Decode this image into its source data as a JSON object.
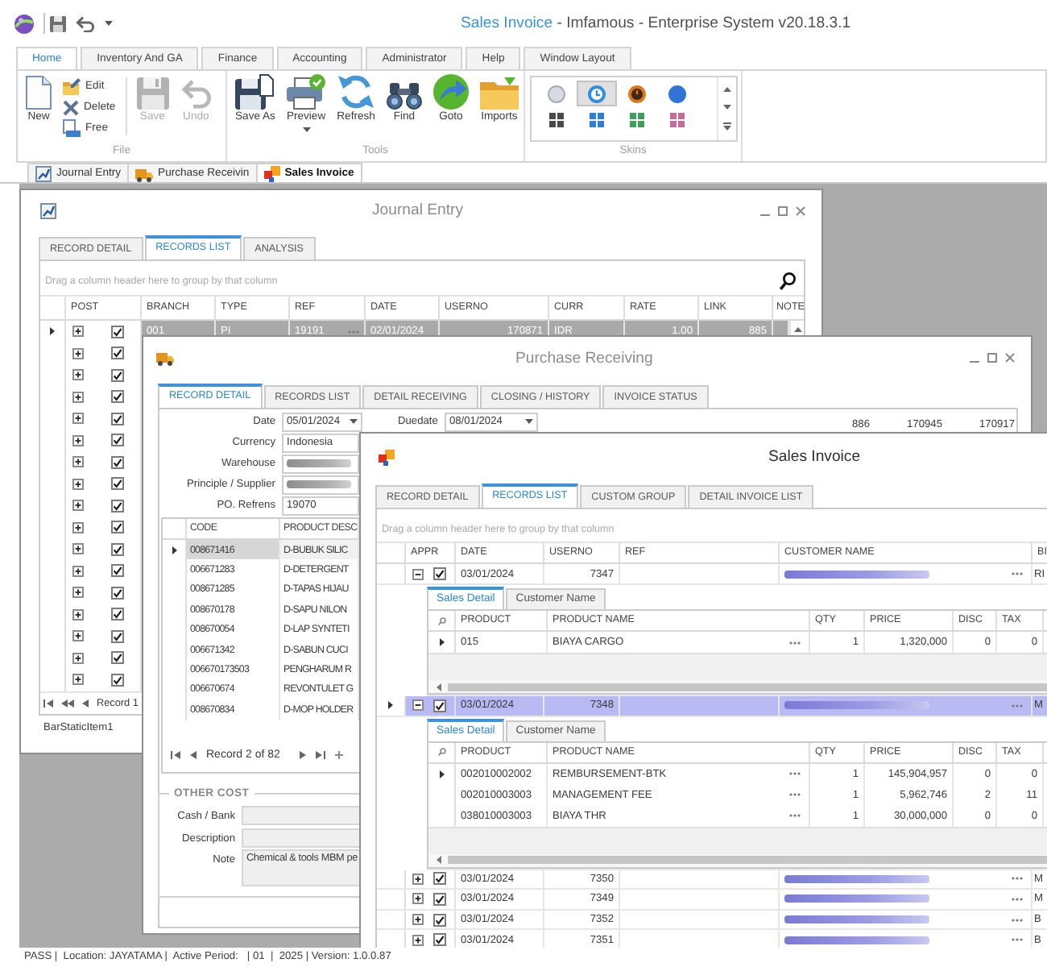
{
  "window": {
    "title": "Sales Invoice",
    "subtitle": "- Imfamous - Enterprise System v20.18.3.1"
  },
  "ribbon": {
    "tabs": [
      {
        "label": "Home",
        "selected": true
      },
      {
        "label": "Inventory And GA",
        "selected": false
      },
      {
        "label": "Finance",
        "selected": false
      },
      {
        "label": "Accounting",
        "selected": false
      },
      {
        "label": "Administrator",
        "selected": false
      },
      {
        "label": "Help",
        "selected": false
      },
      {
        "label": "Window Layout",
        "selected": false
      }
    ],
    "groups": [
      {
        "label": "File",
        "kind": "buttons",
        "items": [
          {
            "kind": "large",
            "label": "New",
            "disabled": false
          },
          {
            "kind": "small",
            "label": "Edit",
            "disabled": false
          },
          {
            "kind": "small",
            "label": "Delete",
            "disabled": false
          },
          {
            "kind": "small",
            "label": "Free",
            "disabled": false
          },
          {
            "kind": "large",
            "label": "Save",
            "disabled": true
          },
          {
            "kind": "large",
            "label": "Undo",
            "disabled": true
          }
        ]
      },
      {
        "label": "Tools",
        "kind": "buttons",
        "items": [
          {
            "kind": "large",
            "label": "Save As",
            "disabled": false
          },
          {
            "kind": "menu",
            "label": "Preview",
            "disabled": false
          },
          {
            "kind": "large",
            "label": "Refresh",
            "disabled": false
          },
          {
            "kind": "large",
            "label": "Find",
            "disabled": false
          },
          {
            "kind": "large",
            "label": "Goto",
            "disabled": false
          },
          {
            "kind": "large",
            "label": "Imports",
            "disabled": false
          }
        ]
      },
      {
        "label": "Skins",
        "kind": "gallery",
        "items": [
          {
            "selected": false
          },
          {
            "selected": true
          },
          {
            "selected": false
          },
          {
            "selected": false
          },
          {
            "selected": false
          },
          {
            "selected": false
          },
          {
            "selected": false
          },
          {
            "selected": false
          }
        ]
      }
    ]
  },
  "document_tabs": [
    {
      "label": "Journal Entry",
      "selected": false
    },
    {
      "label": "Purchase Receivin",
      "selected": false
    },
    {
      "label": "Sales Invoice",
      "selected": true
    }
  ],
  "windows": [
    {
      "kind": "journal",
      "title": "Journal Entry",
      "active": false,
      "controls": true,
      "tabs": [
        {
          "label": "RECORD DETAIL",
          "selected": false
        },
        {
          "label": "RECORDS LIST",
          "selected": true
        },
        {
          "label": "ANALYSIS",
          "selected": false
        }
      ],
      "group_hint": "Drag a column header here to group by that column",
      "columns": [
        "POST",
        "BRANCH",
        "TYPE",
        "REF",
        "DATE",
        "USERNO",
        "CURR",
        "RATE",
        "LINK",
        "NOTE"
      ],
      "rows": [
        {
          "selected": true,
          "expanded": false,
          "posted": true,
          "cells": [
            "001",
            "PI",
            "19191",
            "02/01/2024",
            "170871",
            "IDR",
            "1.00",
            "885"
          ]
        },
        {
          "selected": false,
          "expanded": false,
          "posted": true
        },
        {
          "selected": false,
          "expanded": false,
          "posted": true
        },
        {
          "selected": false,
          "expanded": false,
          "posted": true
        },
        {
          "selected": false,
          "expanded": false,
          "posted": true
        },
        {
          "selected": false,
          "expanded": false,
          "posted": true
        },
        {
          "selected": false,
          "expanded": false,
          "posted": true
        },
        {
          "selected": false,
          "expanded": false,
          "posted": true
        },
        {
          "selected": false,
          "expanded": false,
          "posted": true
        },
        {
          "selected": false,
          "expanded": false,
          "posted": true
        },
        {
          "selected": false,
          "expanded": false,
          "posted": true
        },
        {
          "selected": false,
          "expanded": false,
          "posted": true
        },
        {
          "selected": false,
          "expanded": false,
          "posted": true
        },
        {
          "selected": false,
          "expanded": false,
          "posted": true
        },
        {
          "selected": false,
          "expanded": false,
          "posted": true
        },
        {
          "selected": false,
          "expanded": false,
          "posted": true
        },
        {
          "selected": false,
          "expanded": false,
          "posted": true
        }
      ],
      "navigator": "Record 1",
      "footer": "BarStaticItem1"
    },
    {
      "kind": "receiving",
      "title": "Purchase Receiving",
      "active": false,
      "controls": true,
      "tabs": [
        {
          "label": "RECORD DETAIL",
          "selected": true
        },
        {
          "label": "RECORDS LIST",
          "selected": false
        },
        {
          "label": "DETAIL RECEIVING",
          "selected": false
        },
        {
          "label": "CLOSING / HISTORY",
          "selected": false
        },
        {
          "label": "INVOICE STATUS",
          "selected": false
        }
      ],
      "fields": [
        {
          "label": "Date",
          "kind": "date",
          "value": "05/01/2024"
        },
        {
          "label": "Currency",
          "kind": "text",
          "value": "Indonesia"
        },
        {
          "label": "Warehouse",
          "kind": "blurred"
        },
        {
          "label": "Principle / Supplier",
          "kind": "blurred"
        },
        {
          "label": "PO. Refrens",
          "kind": "text",
          "value": "19070"
        }
      ],
      "due_field": {
        "label": "Duedate",
        "kind": "date",
        "value": "08/01/2024"
      },
      "side_values": [
        "886",
        "170945",
        "170917"
      ],
      "columns": [
        "CODE",
        "PRODUCT DESC"
      ],
      "rows": [
        {
          "selected": true,
          "cells": [
            "008671416",
            "D-BUBUK SILIC"
          ]
        },
        {
          "selected": false,
          "cells": [
            "006671283",
            "D-DETERGENT"
          ]
        },
        {
          "selected": false,
          "cells": [
            "008671285",
            "D-TAPAS HIJAU"
          ]
        },
        {
          "selected": false,
          "cells": [
            "008670178",
            "D-SAPU NILON"
          ]
        },
        {
          "selected": false,
          "cells": [
            "008670054",
            "D-LAP SYNTETI"
          ]
        },
        {
          "selected": false,
          "cells": [
            "006671342",
            "D-SABUN CUCI"
          ]
        },
        {
          "selected": false,
          "cells": [
            "006670173503",
            "PENGHARUM R"
          ]
        },
        {
          "selected": false,
          "cells": [
            "006670674",
            "REVONTULET G"
          ]
        },
        {
          "selected": false,
          "cells": [
            "008670834",
            "D-MOP HOLDER"
          ]
        }
      ],
      "navigator": "Record 2 of 82",
      "other_cost": {
        "title": "OTHER COST",
        "fields": [
          {
            "label": "Cash / Bank",
            "kind": "text"
          },
          {
            "label": "Description",
            "kind": "text"
          },
          {
            "label": "Note",
            "kind": "memo",
            "value": "Chemical & tools MBM pe"
          }
        ]
      }
    },
    {
      "kind": "invoice",
      "title": "Sales Invoice",
      "active": true,
      "tabs": [
        {
          "label": "RECORD DETAIL",
          "selected": false
        },
        {
          "label": "RECORDS LIST",
          "selected": true
        },
        {
          "label": "CUSTOM GROUP",
          "selected": false
        },
        {
          "label": "DETAIL INVOICE LIST",
          "selected": false
        }
      ],
      "group_hint": "Drag a column header here to group by that column",
      "columns": [
        "APPR",
        "DATE",
        "USERNO",
        "REF",
        "CUSTOMER NAME",
        "BI"
      ],
      "rows": [
        {
          "selected": false,
          "expanded": true,
          "approved": true,
          "date": "03/01/2024",
          "userno": "7347",
          "customer_blurred": true,
          "column_6": "RI",
          "detail": {
            "tabs": [
              {
                "label": "Sales Detail",
                "selected": true
              },
              {
                "label": "Customer Name",
                "selected": false
              }
            ],
            "columns": [
              "PRODUCT",
              "PRODUCT NAME",
              "QTY",
              "PRICE",
              "DISC",
              "TAX"
            ],
            "rows": [
              {
                "selected": true,
                "cells": [
                  "015",
                  "BIAYA CARGO",
                  "1",
                  "1,320,000",
                  "0",
                  "0"
                ]
              }
            ]
          }
        },
        {
          "selected": true,
          "expanded": true,
          "approved": true,
          "date": "03/01/2024",
          "userno": "7348",
          "customer_blurred": true,
          "column_6": "M",
          "detail": {
            "tabs": [
              {
                "label": "Sales Detail",
                "selected": true
              },
              {
                "label": "Customer Name",
                "selected": false
              }
            ],
            "columns": [
              "PRODUCT",
              "PRODUCT NAME",
              "QTY",
              "PRICE",
              "DISC",
              "TAX"
            ],
            "rows": [
              {
                "selected": true,
                "cells": [
                  "002010002002",
                  "REMBURSEMENT-BTK",
                  "1",
                  "145,904,957",
                  "0",
                  "0"
                ]
              },
              {
                "selected": false,
                "cells": [
                  "002010003003",
                  "MANAGEMENT FEE",
                  "1",
                  "5,962,746",
                  "2",
                  "11"
                ]
              },
              {
                "selected": false,
                "cells": [
                  "038010003003",
                  "BIAYA THR",
                  "1",
                  "30,000,000",
                  "0",
                  "0"
                ]
              }
            ]
          }
        },
        {
          "selected": false,
          "expanded": false,
          "approved": true,
          "date": "03/01/2024",
          "userno": "7350",
          "customer_blurred": true,
          "column_6": "M"
        },
        {
          "selected": false,
          "expanded": false,
          "approved": true,
          "date": "03/01/2024",
          "userno": "7349",
          "customer_blurred": true,
          "column_6": "M"
        },
        {
          "selected": false,
          "expanded": false,
          "approved": true,
          "date": "03/01/2024",
          "userno": "7352",
          "customer_blurred": true,
          "column_6": "B"
        },
        {
          "selected": false,
          "expanded": false,
          "approved": true,
          "date": "03/01/2024",
          "userno": "7351",
          "customer_blurred": true,
          "column_6": "B"
        }
      ]
    }
  ],
  "status_bar": "PASS |  Location: JAYATAMA |  Active Period:   | 01  |  2025 | Version: 1.0.0.87"
}
